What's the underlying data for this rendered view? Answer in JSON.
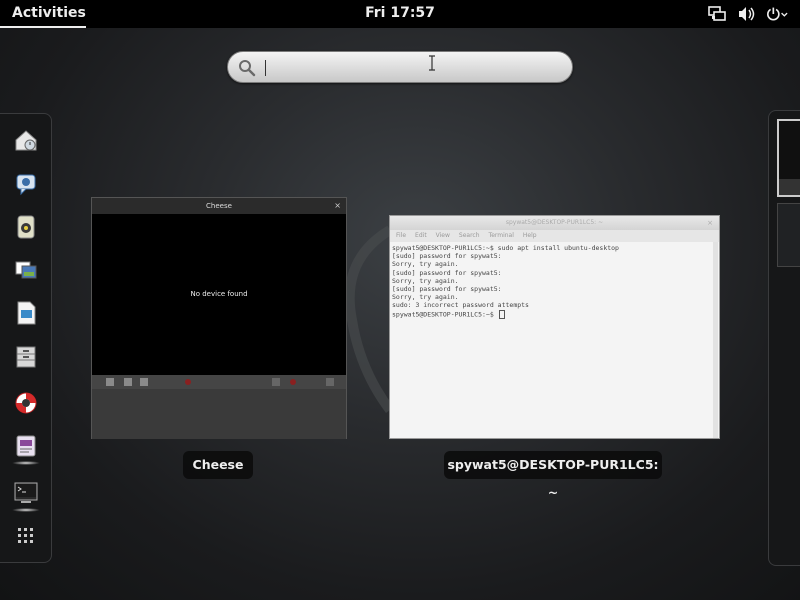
{
  "topbar": {
    "activities": "Activities",
    "clock": "Fri 17:57",
    "tray_icons": [
      "network-icon",
      "volume-icon",
      "power-icon"
    ]
  },
  "search": {
    "value": "",
    "placeholder": ""
  },
  "dash": {
    "items": [
      {
        "name": "mail-icon",
        "running": false
      },
      {
        "name": "chat-icon",
        "running": false
      },
      {
        "name": "music-icon",
        "running": false
      },
      {
        "name": "photos-icon",
        "running": false
      },
      {
        "name": "document-icon",
        "running": false
      },
      {
        "name": "file-cabinet-icon",
        "running": false
      },
      {
        "name": "help-lifebuoy-icon",
        "running": false
      },
      {
        "name": "cheese-icon",
        "running": true
      },
      {
        "name": "terminal-icon",
        "running": true
      },
      {
        "name": "show-apps-icon",
        "running": false
      }
    ]
  },
  "windows": {
    "cheese": {
      "title": "Cheese",
      "message": "No device found",
      "caption": "Cheese"
    },
    "terminal": {
      "title": "spywat5@DESKTOP-PUR1LC5: ~",
      "menu": [
        "File",
        "Edit",
        "View",
        "Search",
        "Terminal",
        "Help"
      ],
      "lines": [
        "spywat5@DESKTOP-PUR1LC5:~$ sudo apt install ubuntu-desktop",
        "[sudo] password for spywat5:",
        "Sorry, try again.",
        "[sudo] password for spywat5:",
        "Sorry, try again.",
        "[sudo] password for spywat5:",
        "Sorry, try again.",
        "sudo: 3 incorrect password attempts"
      ],
      "prompt": "spywat5@DESKTOP-PUR1LC5:~$ ",
      "caption": "spywat5@DESKTOP-PUR1LC5: ~"
    }
  },
  "colors": {
    "topbar": "#000000",
    "accent_text": "#eeeeee",
    "terminal_bg": "#f4f4f4"
  }
}
